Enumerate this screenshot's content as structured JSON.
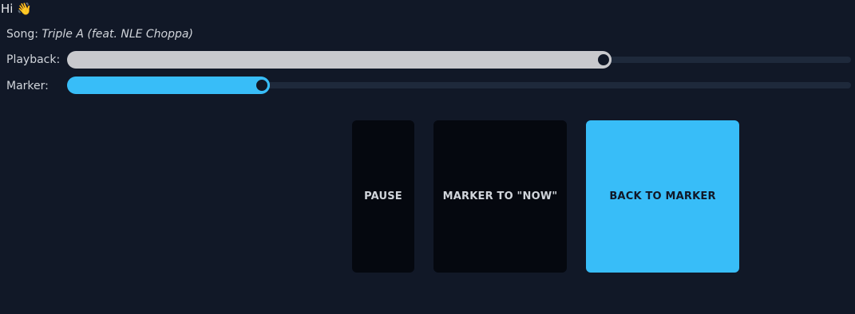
{
  "greeting": {
    "text": "Hi",
    "emoji": "👋"
  },
  "song": {
    "label": "Song:",
    "title": "Triple A (feat. NLE Choppa)"
  },
  "playback": {
    "label": "Playback:",
    "value_fraction": 0.684,
    "fill_color": "#c8c9cd"
  },
  "marker": {
    "label": "Marker:",
    "value_fraction": 0.248,
    "fill_color": "#38bdf8"
  },
  "buttons": {
    "pause": "PAUSE",
    "marker_to_now": "MARKER TO \"NOW\"",
    "back_to_marker": "BACK TO MARKER"
  },
  "colors": {
    "background": "#111827",
    "accent": "#38bdf8",
    "dark_button": "#05080f"
  }
}
